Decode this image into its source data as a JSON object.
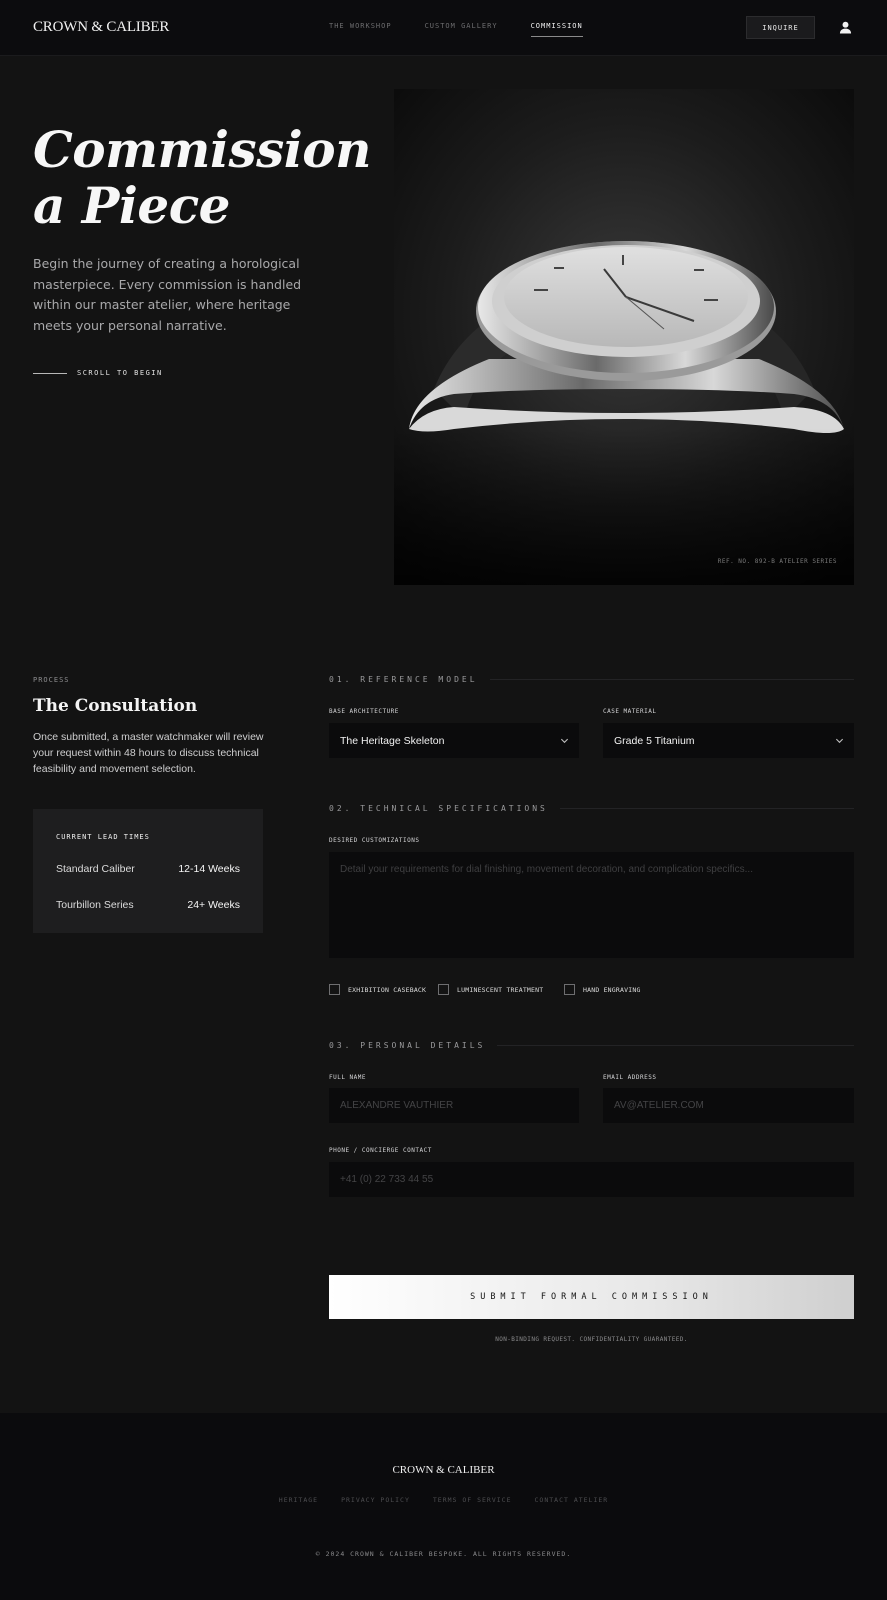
{
  "header": {
    "logo": "CROWN & CALIBER",
    "nav": [
      "THE WORKSHOP",
      "CUSTOM GALLERY",
      "COMMISSION"
    ],
    "active_nav": "COMMISSION",
    "inquire_label": "INQUIRE",
    "user_icon": "user-icon"
  },
  "hero": {
    "title_line1": "Commission",
    "title_line2": "a Piece",
    "intro": "Begin the journey of creating a horological masterpiece. Every commission is handled within our master atelier, where heritage meets your personal narrative.",
    "scroll_label": "SCROLL TO BEGIN",
    "image_caption": "REF. NO. 892-B ATELIER SERIES"
  },
  "process": {
    "eyebrow": "PROCESS",
    "title": "The Consultation",
    "body": "Once submitted, a master watchmaker will review your request within 48 hours to discuss technical feasibility and movement selection.",
    "lead_times": {
      "title": "CURRENT LEAD TIMES",
      "rows": [
        {
          "name": "Standard Caliber",
          "value": "12-14 Weeks"
        },
        {
          "name": "Tourbillon Series",
          "value": "24+ Weeks"
        }
      ]
    }
  },
  "form": {
    "section1": {
      "heading": "01. REFERENCE MODEL",
      "base_label": "BASE ARCHITECTURE",
      "base_value": "The Heritage Skeleton",
      "case_label": "CASE MATERIAL",
      "case_value": "Grade 5 Titanium"
    },
    "section2": {
      "heading": "02. TECHNICAL SPECIFICATIONS",
      "custom_label": "DESIRED CUSTOMIZATIONS",
      "custom_placeholder": "Detail your requirements for dial finishing, movement decoration, and complication specifics...",
      "options": [
        "EXHIBITION CASEBACK",
        "LUMINESCENT TREATMENT",
        "HAND ENGRAVING"
      ]
    },
    "section3": {
      "heading": "03. PERSONAL DETAILS",
      "name_label": "FULL NAME",
      "name_placeholder": "ALEXANDRE VAUTHIER",
      "email_label": "EMAIL ADDRESS",
      "email_placeholder": "AV@ATELIER.COM",
      "phone_label": "PHONE / CONCIERGE CONTACT",
      "phone_placeholder": "+41 (0) 22 733 44 55"
    },
    "submit_label": "SUBMIT FORMAL COMMISSION",
    "submit_note": "NON-BINDING REQUEST. CONFIDENTIALITY GUARANTEED."
  },
  "footer": {
    "logo": "CROWN & CALIBER",
    "links": [
      "HERITAGE",
      "PRIVACY POLICY",
      "TERMS OF SERVICE",
      "CONTACT ATELIER"
    ],
    "copyright": "© 2024 CROWN & CALIBER BESPOKE. ALL RIGHTS RESERVED."
  }
}
